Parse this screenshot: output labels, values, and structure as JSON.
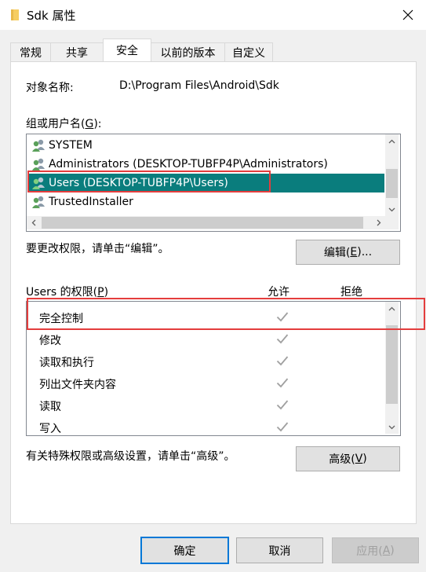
{
  "window": {
    "title": "Sdk 属性"
  },
  "tabs": [
    {
      "label": "常规",
      "active": false
    },
    {
      "label": "共享",
      "active": false
    },
    {
      "label": "安全",
      "active": true
    },
    {
      "label": "以前的版本",
      "active": false
    },
    {
      "label": "自定义",
      "active": false
    }
  ],
  "object": {
    "label": "对象名称:",
    "value": "D:\\Program Files\\Android\\Sdk"
  },
  "groups": {
    "label_pre": "组或用户名(",
    "label_key": "G",
    "label_post": "):",
    "items": [
      {
        "name": "SYSTEM",
        "selected": false
      },
      {
        "name": "Administrators (DESKTOP-TUBFP4P\\Administrators)",
        "selected": false
      },
      {
        "name": "Users (DESKTOP-TUBFP4P\\Users)",
        "selected": true
      },
      {
        "name": "TrustedInstaller",
        "selected": false
      }
    ]
  },
  "edit": {
    "hint": "要更改权限，请单击“编辑”。",
    "button_pre": "编辑(",
    "button_key": "E",
    "button_post": ")..."
  },
  "permissions": {
    "label_pre": "Users 的权限(",
    "label_key": "P",
    "label_post": ")",
    "allow_header": "允许",
    "deny_header": "拒绝",
    "rows": [
      {
        "name": "完全控制",
        "allow": true,
        "deny": false
      },
      {
        "name": "修改",
        "allow": true,
        "deny": false
      },
      {
        "name": "读取和执行",
        "allow": true,
        "deny": false
      },
      {
        "name": "列出文件夹内容",
        "allow": true,
        "deny": false
      },
      {
        "name": "读取",
        "allow": true,
        "deny": false
      },
      {
        "name": "写入",
        "allow": true,
        "deny": false
      }
    ]
  },
  "advanced": {
    "hint": "有关特殊权限或高级设置，请单击“高级”。",
    "button_pre": "高级(",
    "button_key": "V",
    "button_post": ")"
  },
  "footer": {
    "ok": "确定",
    "cancel": "取消",
    "apply_pre": "应用(",
    "apply_key": "A",
    "apply_post": ")"
  },
  "colors": {
    "selection": "#0a7d7d",
    "annotation": "#e43d3d",
    "default_button_border": "#0078d7",
    "check_gray": "#a0a0a0"
  },
  "icons": [
    "folder-icon",
    "close-icon",
    "users-group-icon",
    "check-icon",
    "arrow-up-icon",
    "arrow-down-icon",
    "arrow-left-icon",
    "arrow-right-icon"
  ]
}
